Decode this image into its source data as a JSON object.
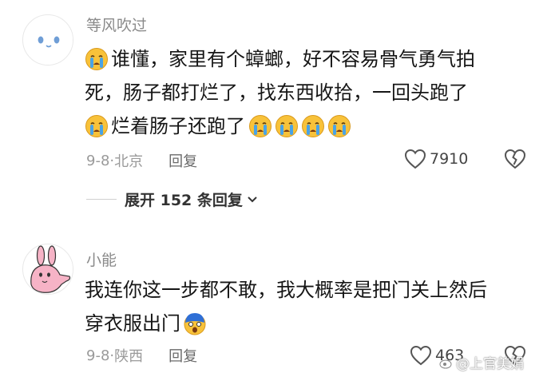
{
  "comments": [
    {
      "username": "等风吹过",
      "lines": [
        {
          "lead_emoji": "crying-face-emoji",
          "text": "谁懂，家里有个蟑螂，好不容易骨气勇气拍",
          "tail_emojis": []
        },
        {
          "lead_emoji": null,
          "text": "死，肠子都打烂了，找东西收拾，一回头跑了",
          "tail_emojis": []
        },
        {
          "lead_emoji": "crying-face-emoji",
          "text": "烂着肠子还跑了",
          "tail_emojis": [
            "crying-face-emoji",
            "crying-face-emoji",
            "crying-face-emoji",
            "crying-face-emoji"
          ]
        }
      ],
      "date": "9-8",
      "separator": "·",
      "location": "北京",
      "reply_label": "回复",
      "like_count": "7910"
    },
    {
      "username": "小能",
      "lines": [
        {
          "lead_emoji": null,
          "text": "我连你这一步都不敢，我大概率是把门关上然后",
          "tail_emojis": []
        },
        {
          "lead_emoji": null,
          "text": "穿衣服出门",
          "tail_emojis": [
            "scared-face-emoji"
          ]
        }
      ],
      "date": "9-8",
      "separator": "·",
      "location": "陕西",
      "reply_label": "回复",
      "like_count": "463"
    }
  ],
  "expand_replies": {
    "label": "展开 152 条回复"
  },
  "watermark": {
    "text": "@上官美娟"
  },
  "colors": {
    "meta": "#9a9a9a",
    "username": "#8a8a8a",
    "text": "#161616",
    "emoji_face": "#f8c23a",
    "emoji_tear": "#4aa3e6"
  }
}
